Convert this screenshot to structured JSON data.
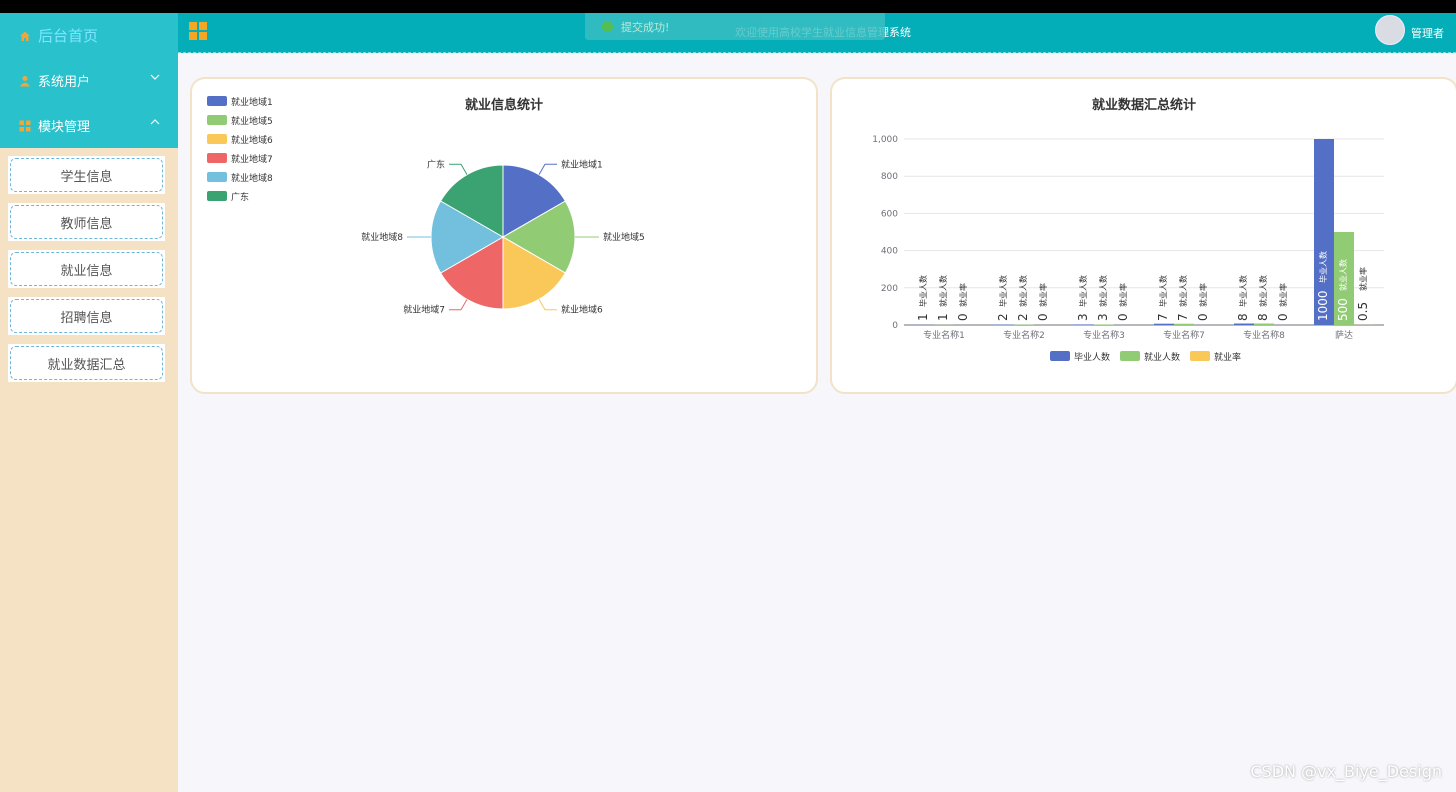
{
  "header": {
    "title": "欢迎使用高校学生就业信息管理系统",
    "user": "管理者",
    "toast": "提交成功!"
  },
  "sidebar": {
    "home": "后台首页",
    "groups": [
      {
        "label": "系统用户"
      },
      {
        "label": "模块管理"
      }
    ],
    "items": [
      {
        "label": "学生信息"
      },
      {
        "label": "教师信息"
      },
      {
        "label": "就业信息"
      },
      {
        "label": "招聘信息"
      },
      {
        "label": "就业数据汇总"
      }
    ]
  },
  "pie_card": {
    "title": "就业信息统计"
  },
  "bar_card": {
    "title": "就业数据汇总统计"
  },
  "watermark": "CSDN @vx_Biye_Design",
  "colors": {
    "accent": "#04aeb8",
    "blue": "#5470c6",
    "green": "#91cc75",
    "yellow": "#fac858",
    "red": "#ee6666",
    "sky": "#73c0de",
    "teal": "#3ba272"
  },
  "chart_data": [
    {
      "type": "pie",
      "title": "就业信息统计",
      "legend_position": "top-left",
      "categories": [
        "就业地域1",
        "就业地域5",
        "就业地域6",
        "就业地域7",
        "就业地域8",
        "广东"
      ],
      "values": [
        1,
        1,
        1,
        1,
        1,
        1
      ],
      "colors": [
        "#5470c6",
        "#91cc75",
        "#fac858",
        "#ee6666",
        "#73c0de",
        "#3ba272"
      ]
    },
    {
      "type": "bar",
      "title": "就业数据汇总统计",
      "legend_position": "bottom",
      "categories": [
        "专业名称1",
        "专业名称2",
        "专业名称3",
        "专业名称7",
        "专业名称8",
        "萨达"
      ],
      "ylim": [
        0,
        1000
      ],
      "yticks": [
        "0",
        "200",
        "400",
        "600",
        "800",
        "1,000"
      ],
      "series": [
        {
          "name": "毕业人数",
          "values": [
            1,
            2,
            3,
            7,
            8,
            1000
          ],
          "color": "#5470c6"
        },
        {
          "name": "就业人数",
          "values": [
            1,
            2,
            3,
            7,
            8,
            500
          ],
          "color": "#91cc75"
        },
        {
          "name": "就业率",
          "values": [
            0,
            0,
            0,
            0,
            0,
            0.5
          ],
          "color": "#fac858"
        }
      ]
    }
  ]
}
